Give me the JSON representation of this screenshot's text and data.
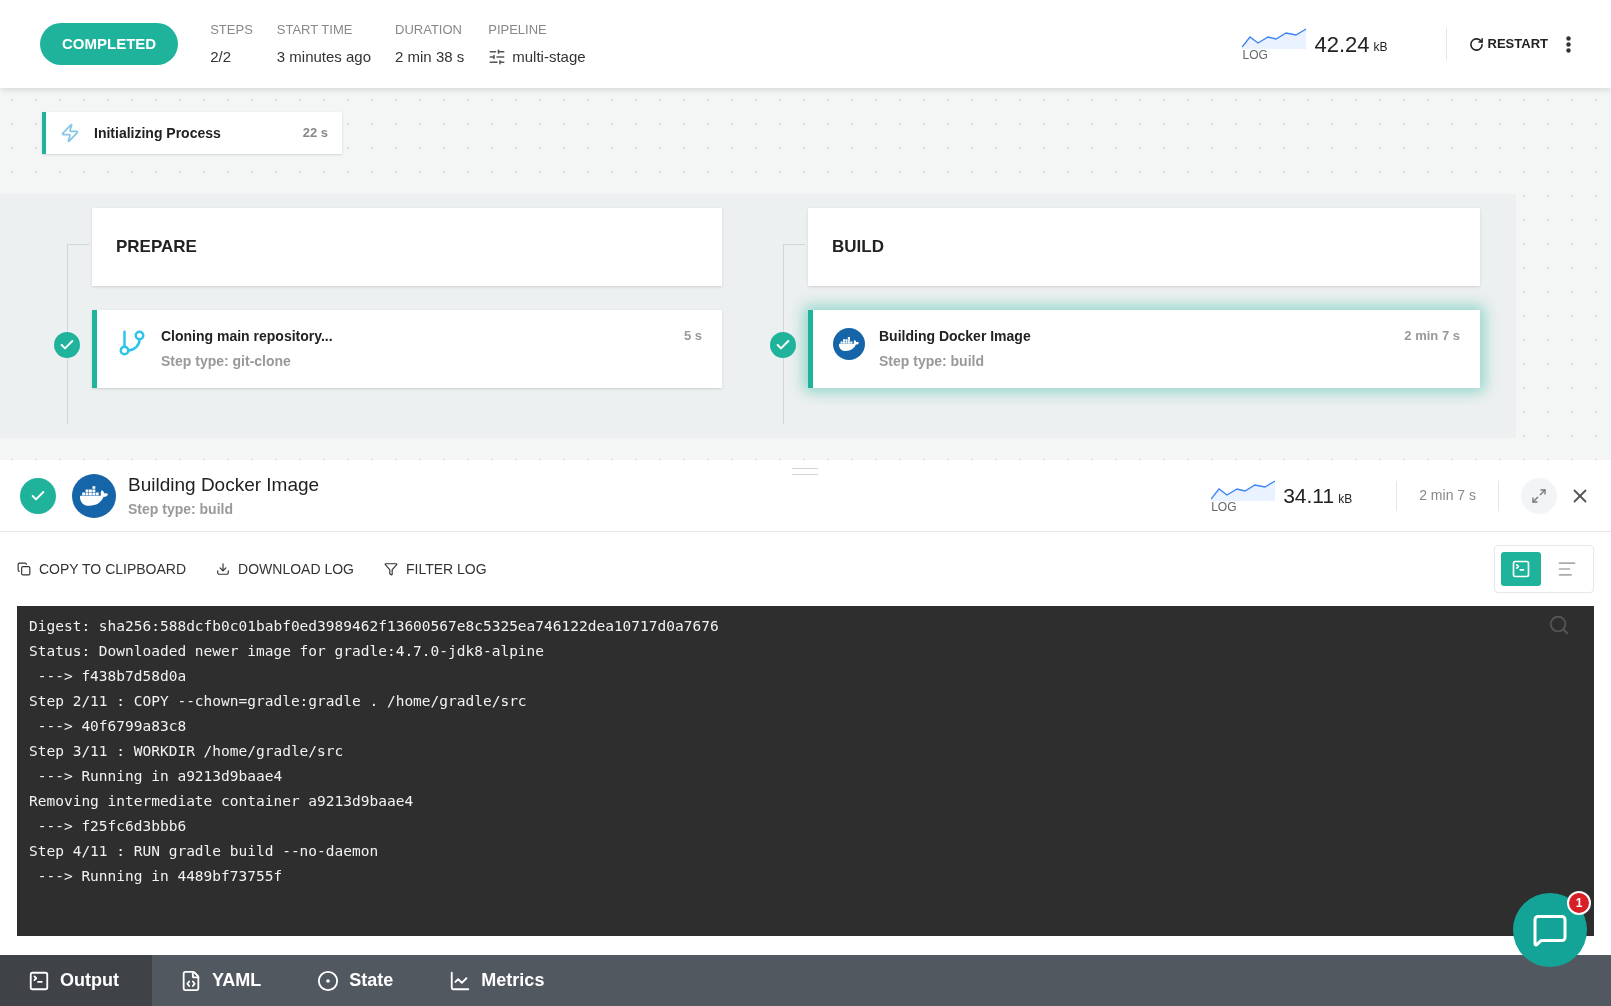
{
  "header": {
    "status": "COMPLETED",
    "stats": [
      {
        "kind": "text",
        "label": "STEPS",
        "value": "2/2"
      },
      {
        "kind": "text",
        "label": "START TIME",
        "value": "3 minutes ago"
      },
      {
        "kind": "text",
        "label": "DURATION",
        "value": "2 min 38 s"
      },
      {
        "kind": "pipeline",
        "label": "PIPELINE",
        "value": "multi-stage"
      }
    ],
    "log": {
      "label": "LOG",
      "size": "42.24",
      "unit": "kB"
    },
    "restart": "RESTART"
  },
  "init": {
    "name": "Initializing Process",
    "duration": "22 s"
  },
  "stages": [
    {
      "title": "PREPARE",
      "steps": [
        {
          "name": "Cloning main repository...",
          "type": "Step type: git-clone",
          "duration": "5 s",
          "kind": "git",
          "done": true,
          "selected": false
        }
      ]
    },
    {
      "title": "BUILD",
      "steps": [
        {
          "name": "Building Docker Image",
          "type": "Step type: build",
          "duration": "2 min 7 s",
          "kind": "docker",
          "done": true,
          "selected": true
        }
      ]
    }
  ],
  "details": {
    "done": true,
    "title": "Building Docker Image",
    "subtitle": "Step type: build",
    "log_label": "LOG",
    "size": "34.11",
    "unit": "kB",
    "duration": "2 min 7 s"
  },
  "actions": [
    {
      "kind": "copy",
      "label": "COPY TO CLIPBOARD"
    },
    {
      "kind": "download",
      "label": "DOWNLOAD LOG"
    },
    {
      "kind": "filter",
      "label": "FILTER LOG"
    }
  ],
  "views": [
    {
      "kind": "terminal",
      "selected": true
    },
    {
      "kind": "text",
      "selected": false
    }
  ],
  "log_lines": [
    "Digest: sha256:588dcfb0c01babf0ed3989462f13600567e8c5325ea746122dea10717d0a7676",
    "Status: Downloaded newer image for gradle:4.7.0-jdk8-alpine",
    " ---> f438b7d58d0a",
    "Step 2/11 : COPY --chown=gradle:gradle . /home/gradle/src",
    " ---> 40f6799a83c8",
    "Step 3/11 : WORKDIR /home/gradle/src",
    " ---> Running in a9213d9baae4",
    "Removing intermediate container a9213d9baae4",
    " ---> f25fc6d3bbb6",
    "Step 4/11 : RUN gradle build --no-daemon",
    " ---> Running in 4489bf73755f"
  ],
  "tabs": [
    {
      "kind": "output",
      "label": "Output",
      "selected": true
    },
    {
      "kind": "yaml",
      "label": "YAML",
      "selected": false
    },
    {
      "kind": "state",
      "label": "State",
      "selected": false
    },
    {
      "kind": "metrics",
      "label": "Metrics",
      "selected": false
    }
  ],
  "chat": {
    "badge": "1"
  }
}
